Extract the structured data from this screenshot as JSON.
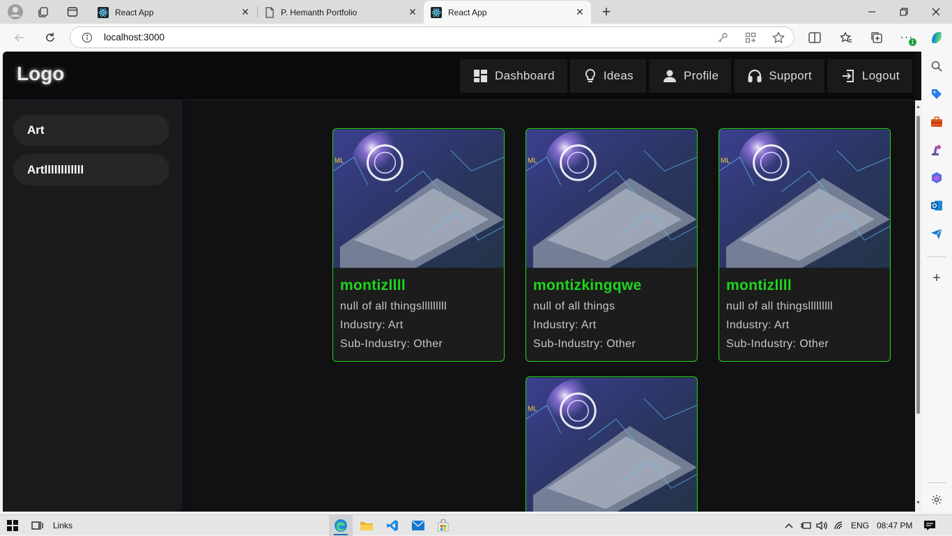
{
  "browser": {
    "tabs": [
      {
        "title": "React App",
        "icon": "react-icon"
      },
      {
        "title": "P. Hemanth Portfolio",
        "icon": "page-icon"
      },
      {
        "title": "React App",
        "icon": "react-icon"
      }
    ],
    "url": "localhost:3000",
    "extension_badge": "1"
  },
  "app": {
    "logo": "Logo",
    "nav": [
      {
        "label": "Dashboard",
        "icon": "dashboard-icon"
      },
      {
        "label": "Ideas",
        "icon": "lightbulb-icon"
      },
      {
        "label": "Profile",
        "icon": "person-icon"
      },
      {
        "label": "Support",
        "icon": "headset-icon"
      },
      {
        "label": "Logout",
        "icon": "logout-icon"
      }
    ],
    "categories": [
      "Art",
      "Artllllllllllll"
    ],
    "cards": [
      {
        "name": "montizllll",
        "description": "null of all thingslllllllll",
        "industry": "Industry: Art",
        "sub_industry": "Sub-Industry: Other"
      },
      {
        "name": "montizkingqwe",
        "description": "null of all things",
        "industry": "Industry: Art",
        "sub_industry": "Sub-Industry: Other"
      },
      {
        "name": "montizllll",
        "description": "null of all thingslllllllll",
        "industry": "Industry: Art",
        "sub_industry": "Sub-Industry: Other"
      }
    ],
    "accent_color": "#1ed61e"
  },
  "taskbar": {
    "links_label": "Links",
    "language": "ENG",
    "time": "08:47 PM"
  }
}
